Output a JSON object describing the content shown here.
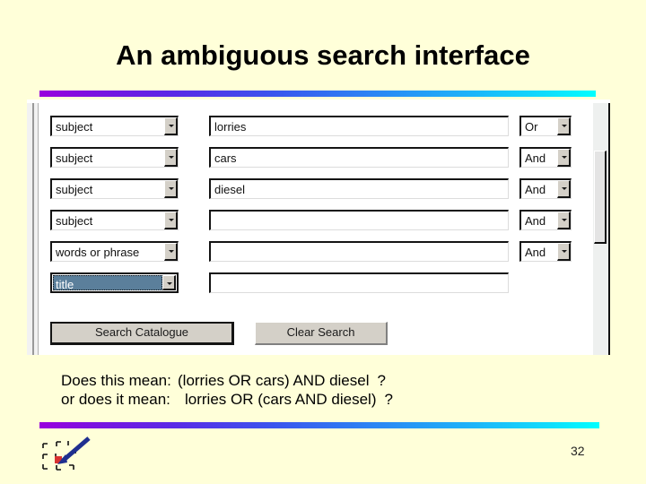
{
  "slide": {
    "title": "An ambiguous search interface",
    "page_number": "32",
    "background_color": "#ffffd9",
    "gradient_start_color": "#9900dd",
    "gradient_end_color": "#00ffff"
  },
  "search_form": {
    "rows": [
      {
        "field": "subject",
        "value": "lorries",
        "operator": "Or"
      },
      {
        "field": "subject",
        "value": "cars",
        "operator": "And"
      },
      {
        "field": "subject",
        "value": "diesel",
        "operator": "And"
      },
      {
        "field": "subject",
        "value": "",
        "operator": "And"
      },
      {
        "field": "words or phrase",
        "value": "",
        "operator": "And"
      },
      {
        "field": "title",
        "value": "",
        "operator": ""
      }
    ],
    "selected_field_row": 6,
    "selection_highlight_color": "#5b7f9b",
    "buttons": {
      "submit_label": "Search Catalogue",
      "clear_label": "Clear Search"
    },
    "field_input_placeholder": ""
  },
  "interpretations": [
    {
      "lead": "Does this mean:",
      "expression": "(lorries OR cars) AND diesel",
      "question_mark": "?"
    },
    {
      "lead": "or does it mean:",
      "expression": "lorries OR (cars AND diesel)",
      "question_mark": "?"
    }
  ],
  "logo": {
    "arrow_color": "#1f2f8f",
    "target_color": "#d83131"
  }
}
